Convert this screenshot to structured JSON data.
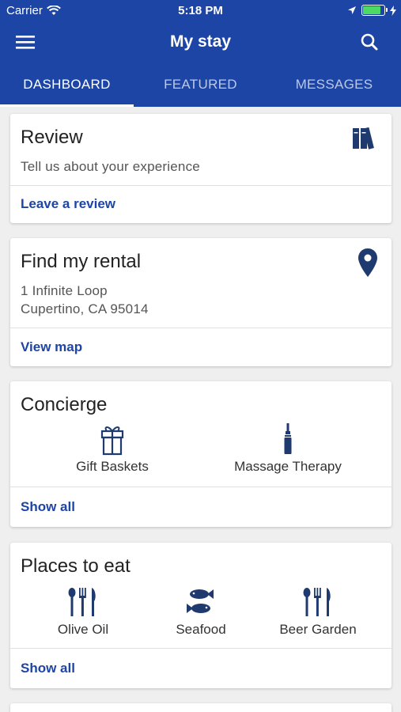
{
  "status": {
    "carrier": "Carrier",
    "time": "5:18 PM"
  },
  "app_bar": {
    "title": "My stay"
  },
  "tabs": [
    {
      "label": "DASHBOARD",
      "active": true
    },
    {
      "label": "FEATURED",
      "active": false
    },
    {
      "label": "MESSAGES",
      "active": false
    }
  ],
  "review": {
    "title": "Review",
    "text": "Tell us about your experience",
    "action": "Leave a review",
    "icon": "books-icon"
  },
  "rental": {
    "title": "Find my rental",
    "address_line1": "1 Infinite Loop",
    "address_line2": "Cupertino, CA 95014",
    "action": "View map",
    "icon": "map-pin-icon"
  },
  "concierge": {
    "title": "Concierge",
    "items": [
      {
        "label": "Gift Baskets",
        "icon": "gift-icon"
      },
      {
        "label": "Massage Therapy",
        "icon": "massage-bottle-icon"
      }
    ],
    "action": "Show all"
  },
  "places": {
    "title": "Places to eat",
    "items": [
      {
        "label": "Olive Oil",
        "icon": "utensils-icon"
      },
      {
        "label": "Seafood",
        "icon": "fish-icon"
      },
      {
        "label": "Beer Garden",
        "icon": "utensils-icon"
      }
    ],
    "action": "Show all"
  },
  "colors": {
    "primary": "#1d45a5",
    "icon": "#1e3a6e",
    "background": "#efefef"
  }
}
